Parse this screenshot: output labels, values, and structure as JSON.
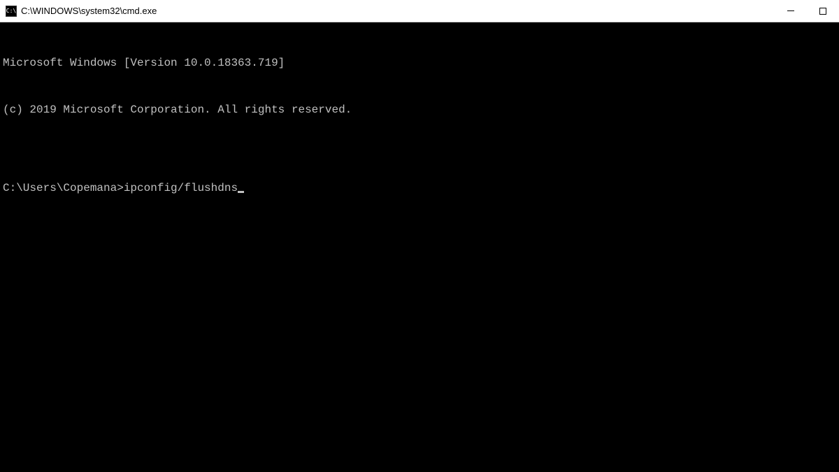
{
  "titlebar": {
    "icon_label": "C:\\",
    "title": "C:\\WINDOWS\\system32\\cmd.exe"
  },
  "terminal": {
    "header_line1": "Microsoft Windows [Version 10.0.18363.719]",
    "header_line2": "(c) 2019 Microsoft Corporation. All rights reserved.",
    "blank": "",
    "prompt": "C:\\Users\\Copemana>",
    "command": "ipconfig/flushdns"
  }
}
